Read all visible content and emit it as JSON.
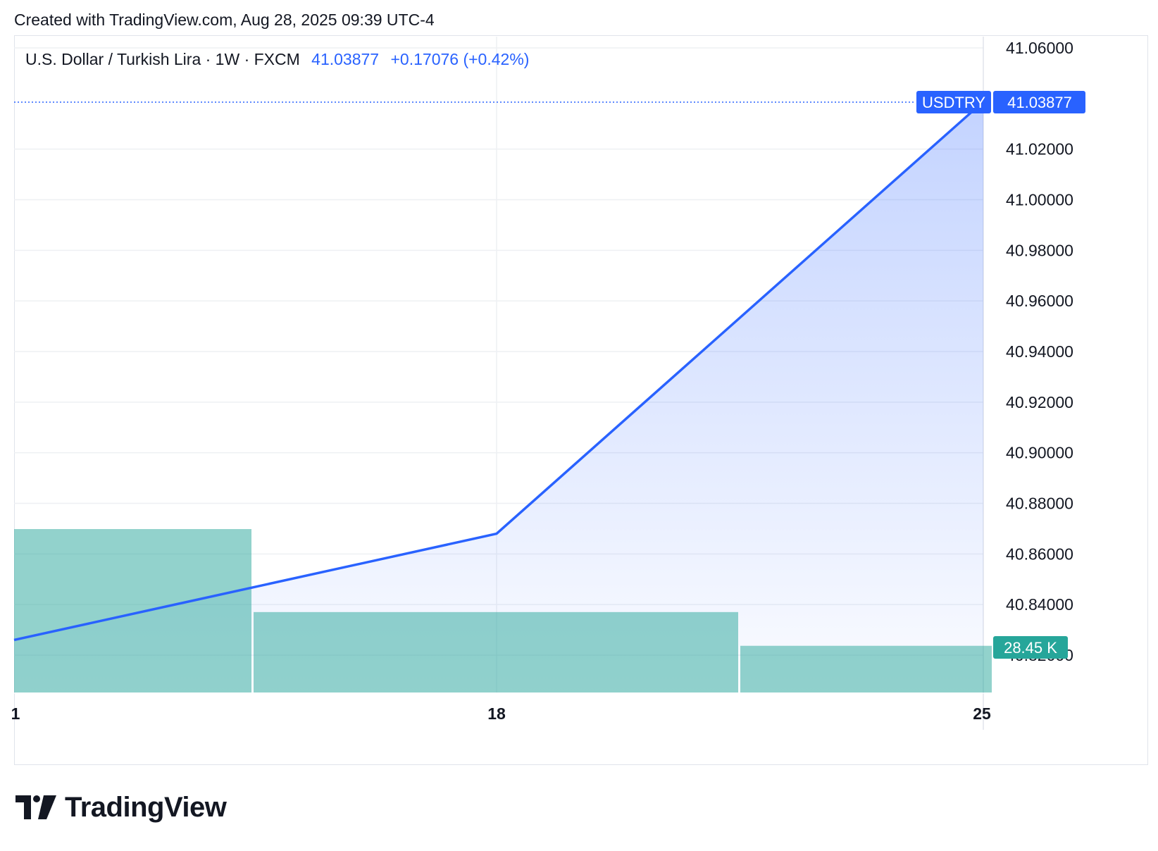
{
  "header": {
    "created_text": "Created with TradingView.com, Aug 28, 2025 09:39 UTC-4"
  },
  "legend": {
    "symbol_text": "U.S. Dollar / Turkish Lira · 1W · FXCM",
    "last_price": "41.03877",
    "change_text": "+0.17076 (+0.42%)"
  },
  "price_tag": {
    "symbol": "USDTRY",
    "value": "41.03877"
  },
  "volume_tag": {
    "value": "28.45 K"
  },
  "brand": {
    "name": "TradingView"
  },
  "colors": {
    "line": "#2962ff",
    "area_top": "#2962ff",
    "volume": "#26a69a",
    "volume_tag_bg": "#26a69a",
    "grid": "#eef0f3"
  },
  "chart_data": {
    "type": "area",
    "x_tick_labels": [
      "1",
      "18",
      "25"
    ],
    "series": [
      {
        "values": [
          {
            "x": "1",
            "y": 40.826
          },
          {
            "x": "18",
            "y": 40.868
          },
          {
            "x": "25",
            "y": 41.03877
          }
        ]
      }
    ],
    "volume": {
      "values": [
        63,
        31,
        18
      ]
    },
    "y_ticks": [
      "41.06000",
      "41.02000",
      "41.00000",
      "40.98000",
      "40.96000",
      "40.94000",
      "40.92000",
      "40.90000",
      "40.88000",
      "40.86000",
      "40.84000",
      "40.82000"
    ],
    "ylim": [
      40.80515,
      41.06
    ],
    "grid": true,
    "last_price_line": 41.03877
  }
}
